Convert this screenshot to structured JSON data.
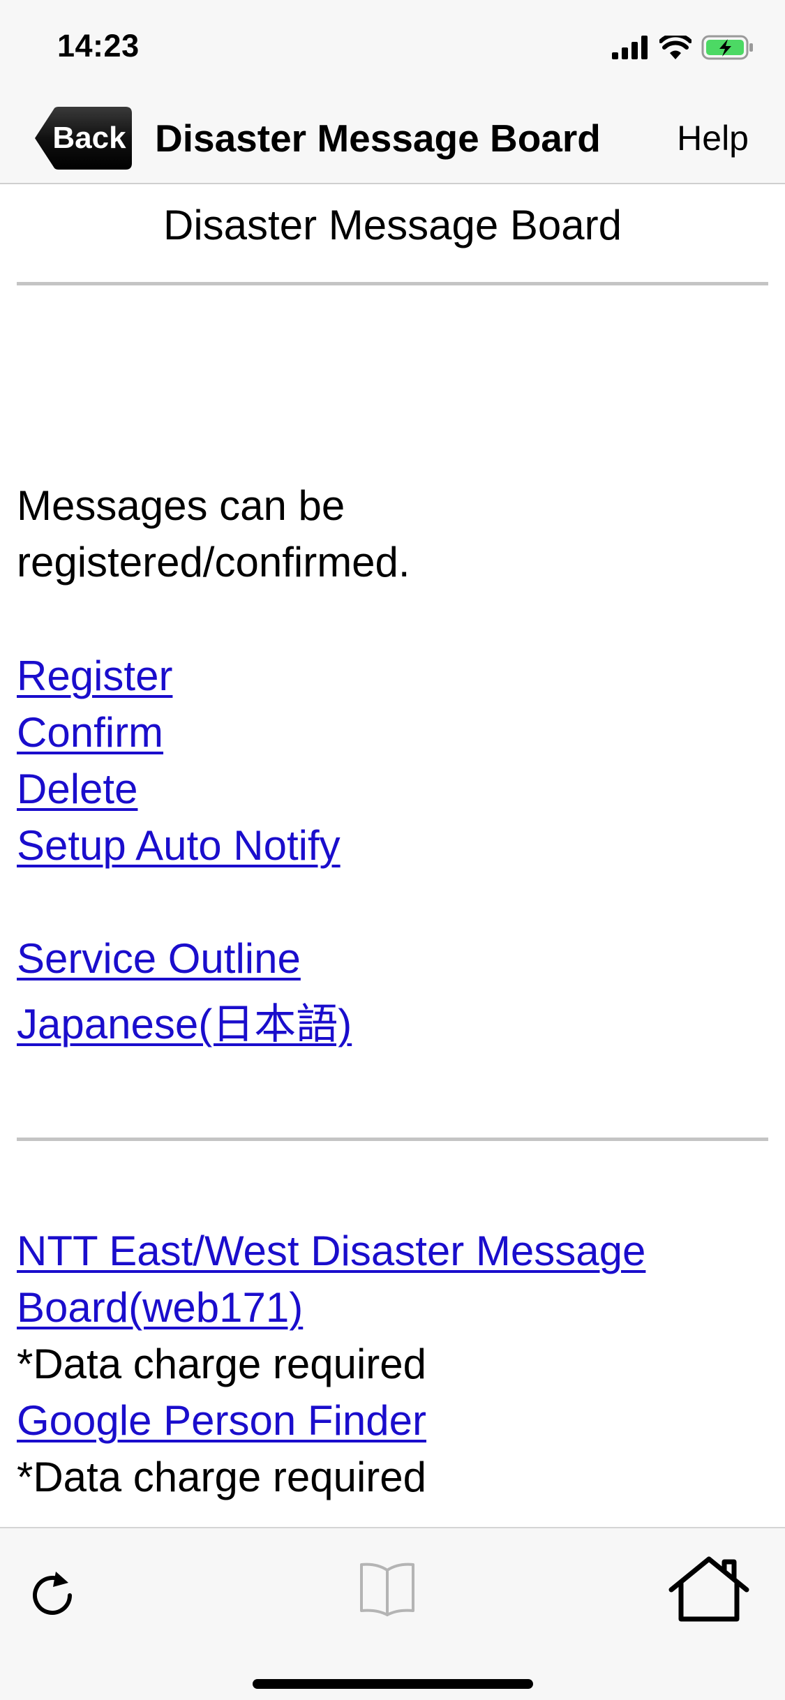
{
  "status_bar": {
    "time": "14:23",
    "icons": [
      "signal-icon",
      "wifi-icon",
      "battery-charging-icon"
    ]
  },
  "nav": {
    "back_label": "Back",
    "title": "Disaster Message Board",
    "help_label": "Help"
  },
  "page": {
    "title": "Disaster Message Board",
    "intro": "Messages can be registered/confirmed.",
    "links": {
      "register": "Register",
      "confirm": "Confirm",
      "delete": "Delete",
      "auto_notify": "Setup Auto Notify",
      "service_outline": "Service Outline",
      "japanese": "Japanese(日本語)"
    },
    "external": {
      "ntt_link": "NTT East/West Disaster Message Board(web171)",
      "ntt_note": "*Data charge required",
      "google_link": "Google Person Finder",
      "google_note": "*Data charge required"
    }
  },
  "toolbar": {
    "icons": [
      "reload-icon",
      "bookmarks-icon",
      "home-icon"
    ]
  },
  "colors": {
    "link": "#1a0dcc",
    "bar_background": "#f7f7f7",
    "divider": "#c4c4c4",
    "battery_green": "#4cd964"
  }
}
